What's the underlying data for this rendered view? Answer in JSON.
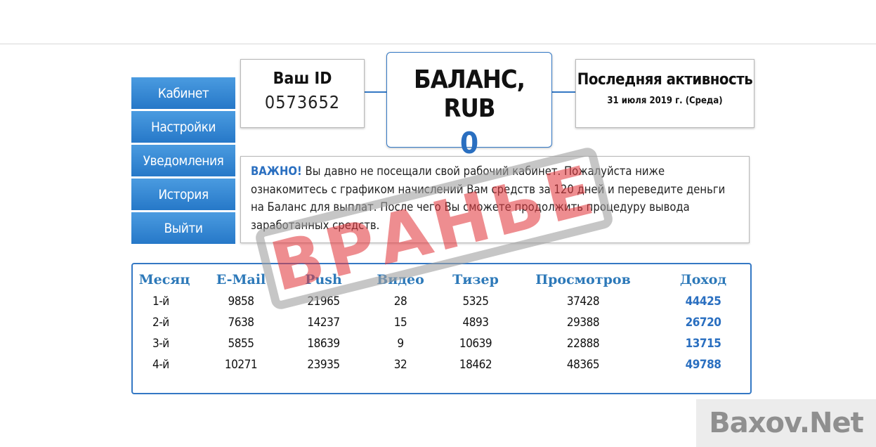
{
  "sidebar": {
    "items": [
      {
        "label": "Кабинет"
      },
      {
        "label": "Настройки"
      },
      {
        "label": "Уведомления"
      },
      {
        "label": "История"
      },
      {
        "label": "Выйти"
      }
    ]
  },
  "id_box": {
    "label": "Ваш ID",
    "value": "0573652"
  },
  "balance_box": {
    "label": "БАЛАНС, RUB",
    "value": "0"
  },
  "activity_box": {
    "label": "Последняя активность",
    "value": "31 июля 2019 г. (Среда)"
  },
  "notice": {
    "important": "ВАЖНО!",
    "text": " Вы давно не посещали свой рабочий кабинет. Пожалуйста ниже ознакомитесь с графиком начислений Вам средств за 120 дней и переведите деньги на Баланс для выплат. После чего Вы сможете продолжить процедуру вывода заработанных средств."
  },
  "table": {
    "headers": [
      "Месяц",
      "E-Mail",
      "Push",
      "Видео",
      "Тизер",
      "Просмотров",
      "Доход"
    ],
    "rows": [
      [
        "1-й",
        "9858",
        "21965",
        "28",
        "5325",
        "37428",
        "44425"
      ],
      [
        "2-й",
        "7638",
        "14237",
        "15",
        "4893",
        "29388",
        "26720"
      ],
      [
        "3-й",
        "5855",
        "18639",
        "9",
        "10639",
        "22888",
        "13715"
      ],
      [
        "4-й",
        "10271",
        "23935",
        "32",
        "18462",
        "48365",
        "49788"
      ]
    ]
  },
  "stamp": {
    "text": "ВРАНЬЕ"
  },
  "watermark": {
    "text": "Baxov.Net"
  }
}
